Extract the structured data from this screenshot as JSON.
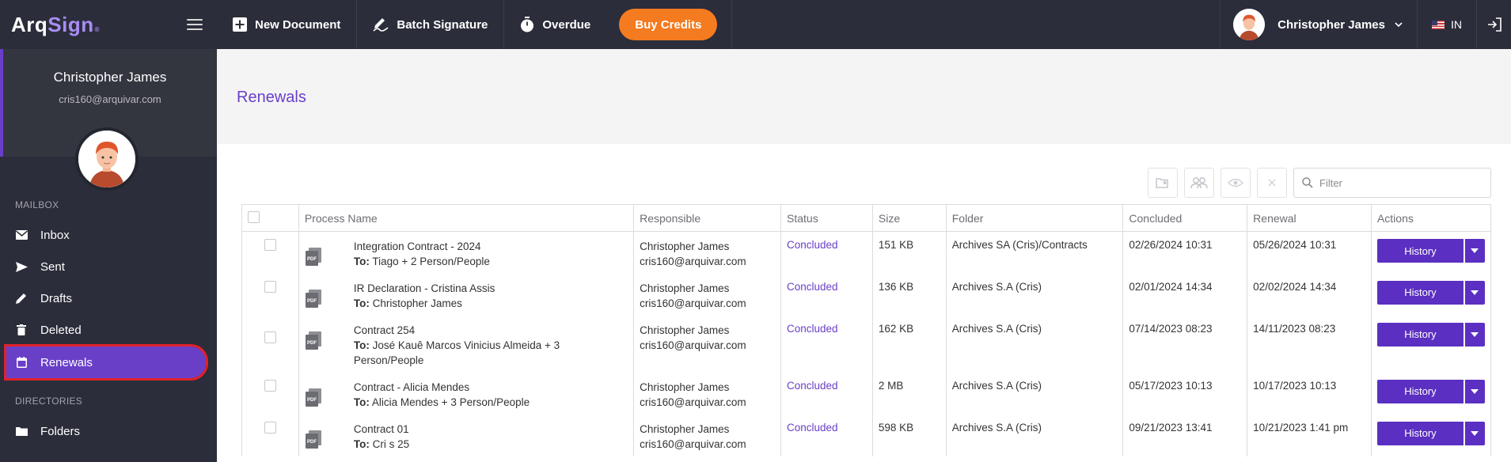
{
  "app": {
    "logo_prefix": "Arq",
    "logo_suffix": "Sign",
    "logo_mark": "®"
  },
  "sidebar": {
    "user_name": "Christopher James",
    "user_email": "cris160@arquivar.com",
    "mailbox_label": "MAILBOX",
    "directories_label": "DIRECTORIES",
    "items": [
      {
        "label": "Inbox",
        "icon": "envelope-icon"
      },
      {
        "label": "Sent",
        "icon": "send-icon"
      },
      {
        "label": "Drafts",
        "icon": "pencil-icon"
      },
      {
        "label": "Deleted",
        "icon": "trash-icon"
      },
      {
        "label": "Renewals",
        "icon": "calendar-icon",
        "active": true
      },
      {
        "label": "Folders",
        "icon": "folder-icon"
      }
    ]
  },
  "topbar": {
    "new_document": "New Document",
    "batch_signature": "Batch Signature",
    "overdue": "Overdue",
    "buy_credits": "Buy Credits",
    "user_name": "Christopher James",
    "language": "IN"
  },
  "page": {
    "title": "Renewals"
  },
  "filter": {
    "placeholder": "Filter"
  },
  "table": {
    "headers": [
      "Process Name",
      "Responsible",
      "Status",
      "Size",
      "Folder",
      "Concluded",
      "Renewal",
      "Actions"
    ],
    "to_label": "To:",
    "action_label": "History",
    "rows": [
      {
        "name": "Integration Contract - 2024",
        "to": "Tiago + 2 Person/People",
        "resp_name": "Christopher James",
        "resp_email": "cris160@arquivar.com",
        "status": "Concluded",
        "size": "151 KB",
        "folder": "Archives SA (Cris)/Contracts",
        "concluded": "02/26/2024 10:31",
        "renewal": "05/26/2024 10:31"
      },
      {
        "name": "IR Declaration - Cristina Assis",
        "to": "Christopher James",
        "resp_name": "Christopher James",
        "resp_email": "cris160@arquivar.com",
        "status": "Concluded",
        "size": "136 KB",
        "folder": "Archives S.A (Cris)",
        "concluded": "02/01/2024 14:34",
        "renewal": "02/02/2024 14:34"
      },
      {
        "name": "Contract 254",
        "to": "José Kauê Marcos Vinicius Almeida + 3",
        "to2": "Person/People",
        "resp_name": "Christopher James",
        "resp_email": "cris160@arquivar.com",
        "status": "Concluded",
        "size": "162 KB",
        "folder": "Archives S.A (Cris)",
        "concluded": "07/14/2023 08:23",
        "renewal": "14/11/2023 08:23"
      },
      {
        "name": "Contract - Alicia Mendes",
        "to": "Alicia Mendes + 3 Person/People",
        "resp_name": "Christopher James",
        "resp_email": "cris160@arquivar.com",
        "status": "Concluded",
        "size": "2 MB",
        "folder": "Archives S.A (Cris)",
        "concluded": "05/17/2023 10:13",
        "renewal": "10/17/2023 10:13"
      },
      {
        "name": "Contract 01",
        "to": "Cri s 25",
        "resp_name": "Christopher James",
        "resp_email": "cris160@arquivar.com",
        "status": "Concluded",
        "size": "598 KB",
        "folder": "Archives S.A (Cris)",
        "concluded": "09/21/2023 13:41",
        "renewal": "10/21/2023 1:41 pm"
      }
    ]
  },
  "colors": {
    "accent": "#6a3fc8",
    "button": "#5b2fc1",
    "orange": "#f47b20",
    "dark": "#2b2d3a",
    "highlight": "#e0222a"
  }
}
